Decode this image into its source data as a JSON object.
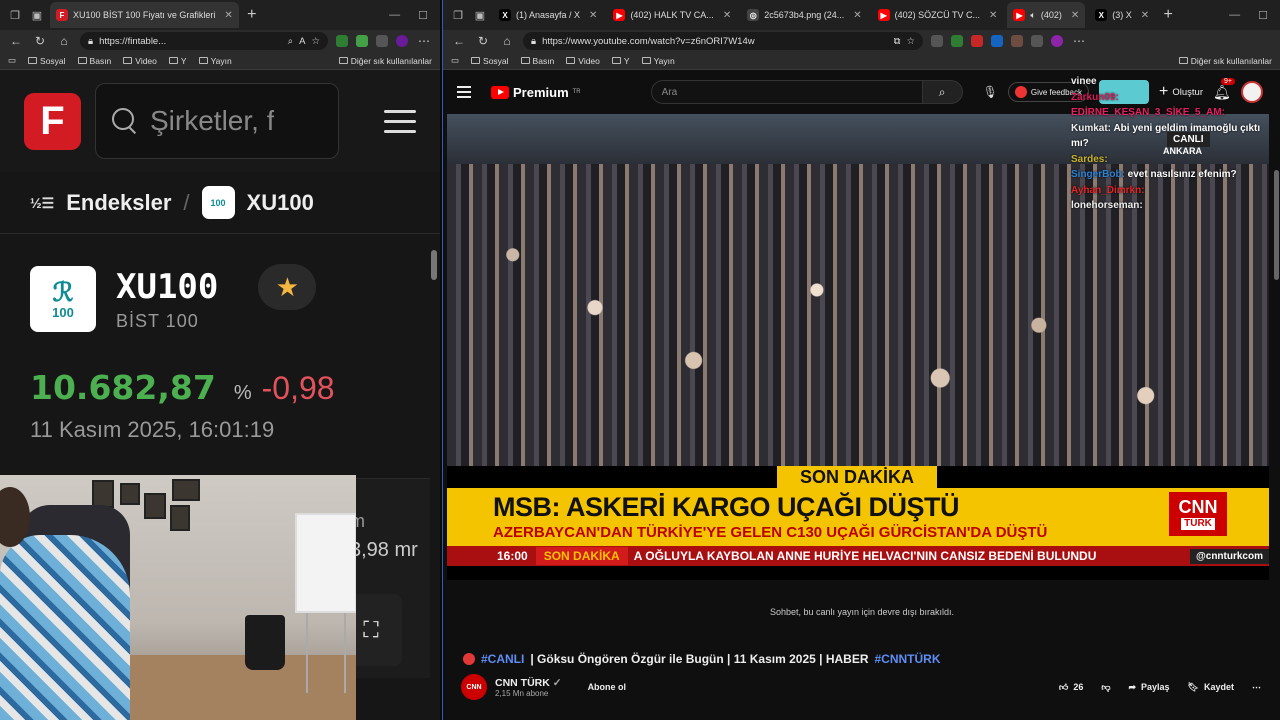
{
  "left_window": {
    "tabs": [
      {
        "label": "XU100 BİST 100 Fiyatı ve Grafikleri",
        "favicon": "F",
        "favicon_color": "#d31b24"
      }
    ],
    "url": "https://fintable...",
    "bookmarks": [
      "Sosyal",
      "Basın",
      "Video",
      "Y",
      "Yayın"
    ],
    "bookmarks_other": "Diğer sık kullanılanlar"
  },
  "fintables": {
    "logo_letter": "F",
    "search_placeholder": "Şirketler, f",
    "breadcrumb_root": "Endeksler",
    "breadcrumb_current": "XU100",
    "index_logo_number": "100",
    "index_code": "XU100",
    "index_name": "BİST 100",
    "price": "10.682,87",
    "change_prefix": "%",
    "change": "-0,98",
    "datetime": "11 Kasım 2025, 16:01:19",
    "partial_label": "m",
    "partial_value": "3,98 mr",
    "colors": {
      "up": "#4caf50",
      "down": "#e2525c",
      "brand": "#d31b24"
    }
  },
  "right_window": {
    "tabs": [
      {
        "label": "(1) Anasayfa / X",
        "favicon": "X",
        "favicon_color": "#000000"
      },
      {
        "label": "(402) HALK TV CA...",
        "favicon": "▶",
        "favicon_color": "#ff0000"
      },
      {
        "label": "2c5673b4.png (24...",
        "favicon": "◎",
        "favicon_color": "#444444"
      },
      {
        "label": "(402) SÖZCÜ TV C...",
        "favicon": "▶",
        "favicon_color": "#ff0000"
      },
      {
        "label": "(402)",
        "favicon": "▶",
        "favicon_color": "#ff0000"
      },
      {
        "label": "(3) X",
        "favicon": "X",
        "favicon_color": "#000000"
      }
    ],
    "url": "https://www.youtube.com/watch?v=z6nORI7W14w",
    "bookmarks": [
      "Sosyal",
      "Basın",
      "Video",
      "Y",
      "Yayın"
    ],
    "bookmarks_other": "Diğer sık kullanılanlar"
  },
  "youtube": {
    "logo_text": "Premium",
    "logo_region": "TR",
    "search_placeholder": "Ara",
    "feedback_label": "Give feedback",
    "create_label": "Oluştur",
    "notif_count": "9+",
    "live_badge": "CANLI",
    "live_location": "ANKARA",
    "son_dakika": "SON DAKİKA",
    "headline": "MSB: ASKERİ KARGO UÇAĞI DÜŞTÜ",
    "subheadline": "AZERBAYCAN'DAN TÜRKİYE'YE GELEN C130 UÇAĞI GÜRCİSTAN'DA DÜŞTÜ",
    "channel_logo_top": "CNN",
    "channel_logo_bottom": "TÜRK",
    "ticker_time": "16:00",
    "ticker_label": "SON DAKİKA",
    "ticker_text": "A OĞLUYLA KAYBOLAN ANNE HURİYE HELVACI'NIN CANSIZ BEDENİ BULUNDU",
    "ticker_handle": "@cnnturkcom",
    "chat_disabled": "Sohbet, bu canlı yayın için devre dışı bırakıldı.",
    "video_title_tag1": "#CANLI",
    "video_title_main": "| Göksu Öngören Özgür ile Bugün | 11 Kasım 2025 | HABER",
    "video_title_tag2": "#CNNTÜRK",
    "channel_name": "CNN TÜRK",
    "channel_subs": "2,15 Mn abone",
    "subscribe_label": "Abone ol",
    "likes": "26",
    "share_label": "Paylaş",
    "save_label": "Kaydet"
  },
  "chat_overlay": [
    {
      "user": "vinee",
      "msg": "",
      "cls": "u7"
    },
    {
      "user": "Zarkun09:",
      "msg": "",
      "cls": "u1"
    },
    {
      "user": "EDİRNE_KEŞAN_3_SİKE_5_AM:",
      "msg": "",
      "cls": "u2"
    },
    {
      "user": "Kumkat:",
      "msg": "Abi yeni geldim imamoğlu çıktı mı?",
      "cls": "u7"
    },
    {
      "user": "Sardes:",
      "msg": "",
      "cls": "u4"
    },
    {
      "user": "SingerBob:",
      "msg": "evet nasılsınız efenim?",
      "cls": "u5"
    },
    {
      "user": "Ayhan_Dimrkn:",
      "msg": "",
      "cls": "u6"
    },
    {
      "user": "lonehorseman:",
      "msg": "",
      "cls": "u7"
    }
  ]
}
